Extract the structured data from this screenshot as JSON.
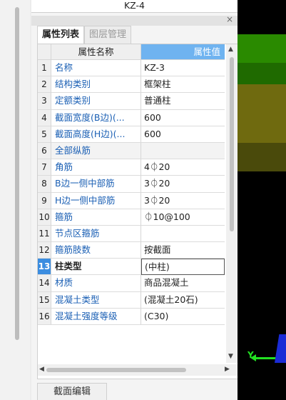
{
  "component_name": "KZ-4",
  "tabs": [
    {
      "label": "属性列表"
    },
    {
      "label": "图层管理"
    }
  ],
  "grid": {
    "header_name": "属性名称",
    "header_value": "属性值",
    "rows": [
      {
        "num": "1",
        "name": "名称",
        "value": "KZ-3"
      },
      {
        "num": "2",
        "name": "结构类别",
        "value": "框架柱"
      },
      {
        "num": "3",
        "name": "定额类别",
        "value": "普通柱"
      },
      {
        "num": "4",
        "name": "截面宽度(B边)(...",
        "value": "600"
      },
      {
        "num": "5",
        "name": "截面高度(H边)(...",
        "value": "600"
      },
      {
        "num": "6",
        "name": "全部纵筋",
        "value": ""
      },
      {
        "num": "7",
        "name": "角筋",
        "value": "4⏀20"
      },
      {
        "num": "8",
        "name": "B边一侧中部筋",
        "value": "3⏀20"
      },
      {
        "num": "9",
        "name": "H边一侧中部筋",
        "value": "3⏀20"
      },
      {
        "num": "10",
        "name": "箍筋",
        "value": "⏀10@100"
      },
      {
        "num": "11",
        "name": "节点区箍筋",
        "value": ""
      },
      {
        "num": "12",
        "name": "箍筋肢数",
        "value": "按截面"
      },
      {
        "num": "13",
        "name": "柱类型",
        "value": "(中柱)"
      },
      {
        "num": "14",
        "name": "材质",
        "value": "商品混凝土"
      },
      {
        "num": "15",
        "name": "混凝土类型",
        "value": "(混凝土20石)"
      },
      {
        "num": "16",
        "name": "混凝土强度等级",
        "value": "(C30)"
      }
    ]
  },
  "section_edit_label": "截面编辑",
  "axis_label": "Y",
  "close_symbol": "×",
  "colors": {
    "header_value_bg": "#6fb3f0",
    "selected_row": "#3b8de0",
    "name_text": "#1a5fb4"
  }
}
